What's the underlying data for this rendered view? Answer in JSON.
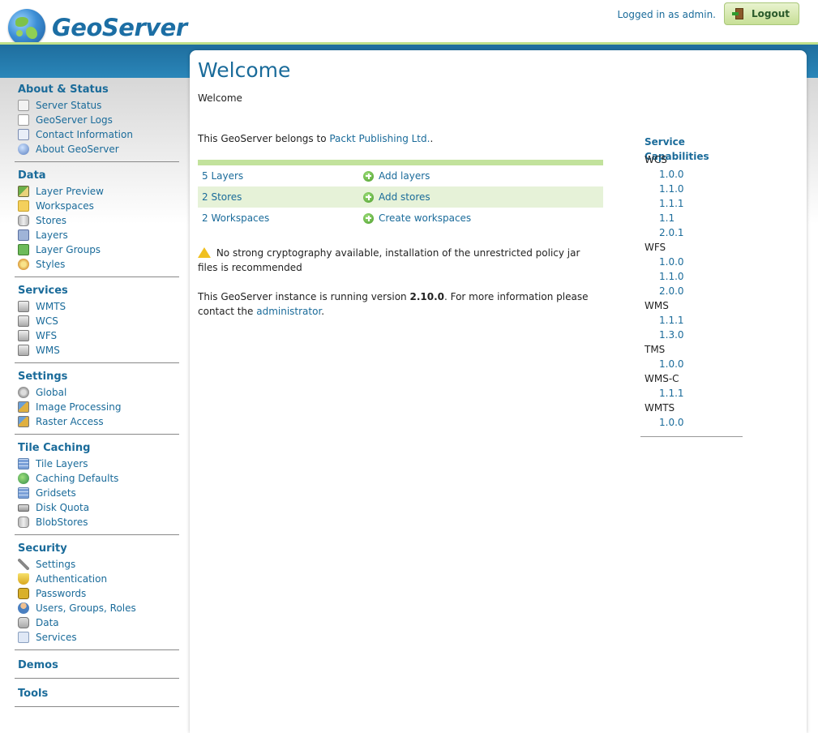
{
  "header": {
    "app_name": "GeoServer",
    "login_status": "Logged in as admin.",
    "logout_label": "Logout"
  },
  "main": {
    "title": "Welcome",
    "subtitle": "Welcome",
    "belongs_prefix": "This GeoServer belongs to ",
    "org_name": "Packt Publishing Ltd.",
    "belongs_suffix": ".",
    "stats": [
      {
        "count": "5 Layers",
        "action": "Add layers"
      },
      {
        "count": "2 Stores",
        "action": "Add stores"
      },
      {
        "count": "2 Workspaces",
        "action": "Create workspaces"
      }
    ],
    "warning_text": "No strong cryptography available, installation of the unrestricted policy jar files is recommended",
    "version_prefix": "This GeoServer instance is running version ",
    "version": "2.10.0",
    "version_middle": ". For more information please contact the ",
    "admin_link": "administrator",
    "version_suffix": "."
  },
  "capabilities": {
    "title": "Service Capabilities",
    "services": [
      {
        "name": "WCS",
        "versions": [
          "1.0.0",
          "1.1.0",
          "1.1.1",
          "1.1",
          "2.0.1"
        ]
      },
      {
        "name": "WFS",
        "versions": [
          "1.0.0",
          "1.1.0",
          "2.0.0"
        ]
      },
      {
        "name": "WMS",
        "versions": [
          "1.1.1",
          "1.3.0"
        ]
      },
      {
        "name": "TMS",
        "versions": [
          "1.0.0"
        ]
      },
      {
        "name": "WMS-C",
        "versions": [
          "1.1.1"
        ]
      },
      {
        "name": "WMTS",
        "versions": [
          "1.0.0"
        ]
      }
    ]
  },
  "sidebar": {
    "groups": [
      {
        "heading": "About & Status",
        "items": [
          {
            "label": "Server Status",
            "icon": "ic-warn"
          },
          {
            "label": "GeoServer Logs",
            "icon": "ic-page"
          },
          {
            "label": "Contact Information",
            "icon": "ic-card"
          },
          {
            "label": "About GeoServer",
            "icon": "ic-help"
          }
        ]
      },
      {
        "heading": "Data",
        "items": [
          {
            "label": "Layer Preview",
            "icon": "ic-map"
          },
          {
            "label": "Workspaces",
            "icon": "ic-folder"
          },
          {
            "label": "Stores",
            "icon": "ic-cyl"
          },
          {
            "label": "Layers",
            "icon": "ic-layer"
          },
          {
            "label": "Layer Groups",
            "icon": "ic-layers"
          },
          {
            "label": "Styles",
            "icon": "ic-palette"
          }
        ]
      },
      {
        "heading": "Services",
        "items": [
          {
            "label": "WMTS",
            "icon": "ic-server"
          },
          {
            "label": "WCS",
            "icon": "ic-server"
          },
          {
            "label": "WFS",
            "icon": "ic-server"
          },
          {
            "label": "WMS",
            "icon": "ic-server"
          }
        ]
      },
      {
        "heading": "Settings",
        "items": [
          {
            "label": "Global",
            "icon": "ic-gear"
          },
          {
            "label": "Image Processing",
            "icon": "ic-image"
          },
          {
            "label": "Raster Access",
            "icon": "ic-image"
          }
        ]
      },
      {
        "heading": "Tile Caching",
        "items": [
          {
            "label": "Tile Layers",
            "icon": "ic-grid"
          },
          {
            "label": "Caching Defaults",
            "icon": "ic-globe"
          },
          {
            "label": "Gridsets",
            "icon": "ic-grid"
          },
          {
            "label": "Disk Quota",
            "icon": "ic-disk"
          },
          {
            "label": "BlobStores",
            "icon": "ic-cyl"
          }
        ]
      },
      {
        "heading": "Security",
        "items": [
          {
            "label": "Settings",
            "icon": "ic-wrench"
          },
          {
            "label": "Authentication",
            "icon": "ic-shield"
          },
          {
            "label": "Passwords",
            "icon": "ic-lock"
          },
          {
            "label": "Users, Groups, Roles",
            "icon": "ic-users"
          },
          {
            "label": "Data",
            "icon": "ic-key"
          },
          {
            "label": "Services",
            "icon": "ic-keyserv"
          }
        ]
      },
      {
        "heading": "Demos",
        "items": []
      },
      {
        "heading": "Tools",
        "items": []
      }
    ]
  }
}
